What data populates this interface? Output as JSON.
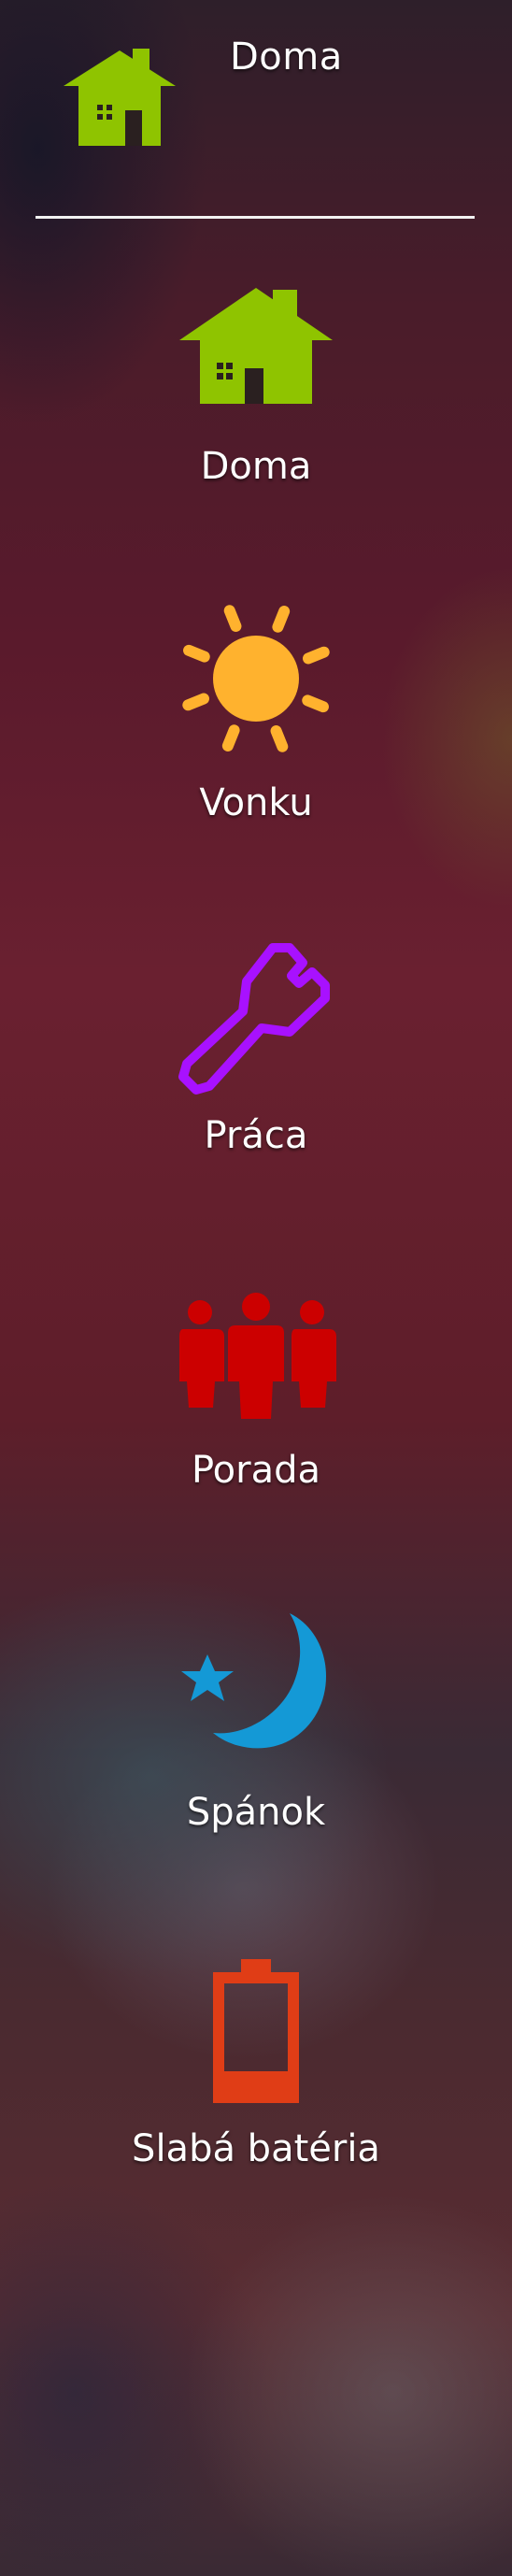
{
  "header": {
    "title": "Doma",
    "icon": "house-icon",
    "icon_color": "#8fc400"
  },
  "modes": [
    {
      "label": "Doma",
      "icon": "house-icon",
      "color": "#8fc400"
    },
    {
      "label": "Vonku",
      "icon": "sun-icon",
      "color": "#ffb22e"
    },
    {
      "label": "Práca",
      "icon": "wrench-icon",
      "color": "#a811ff"
    },
    {
      "label": "Porada",
      "icon": "people-icon",
      "color": "#cc0000"
    },
    {
      "label": "Spánok",
      "icon": "moon-star-icon",
      "color": "#1499d6"
    },
    {
      "label": "Slabá batéria",
      "icon": "battery-low-icon",
      "color": "#e03d16"
    }
  ]
}
